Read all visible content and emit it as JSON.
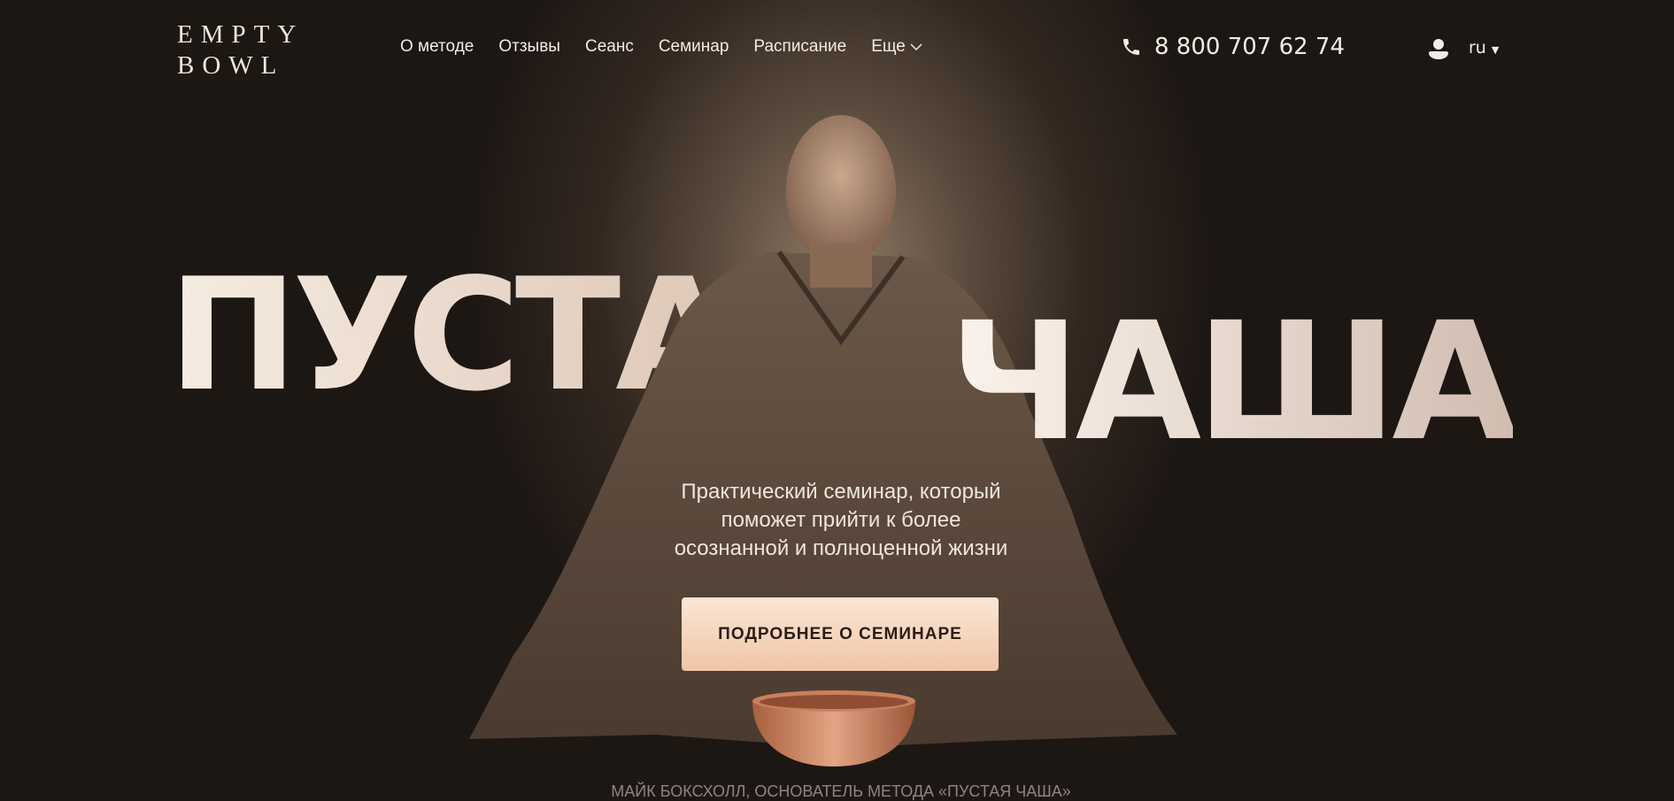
{
  "logo": {
    "line1": "EMPTY",
    "line2": "BOWL"
  },
  "nav": {
    "items": [
      "О методе",
      "Отзывы",
      "Сеанс",
      "Семинар",
      "Расписание",
      "Еще"
    ]
  },
  "header": {
    "phone": "8 800 707 62 74",
    "language": "ru"
  },
  "hero": {
    "title_word1": "ПУСТАЯ",
    "title_word2": "ЧАША",
    "subtitle": [
      "Практический семинар, который",
      "поможет прийти к более",
      "осознанной и полноценной жизни"
    ],
    "cta_label": "ПОДРОБНЕЕ О СЕМИНАРЕ",
    "caption": "МАЙК БОКСХОЛЛ, ОСНОВАТЕЛЬ МЕТОДА «ПУСТАЯ ЧАША»"
  },
  "colors": {
    "background": "#1c1613",
    "accent": "#f0c5a6"
  }
}
